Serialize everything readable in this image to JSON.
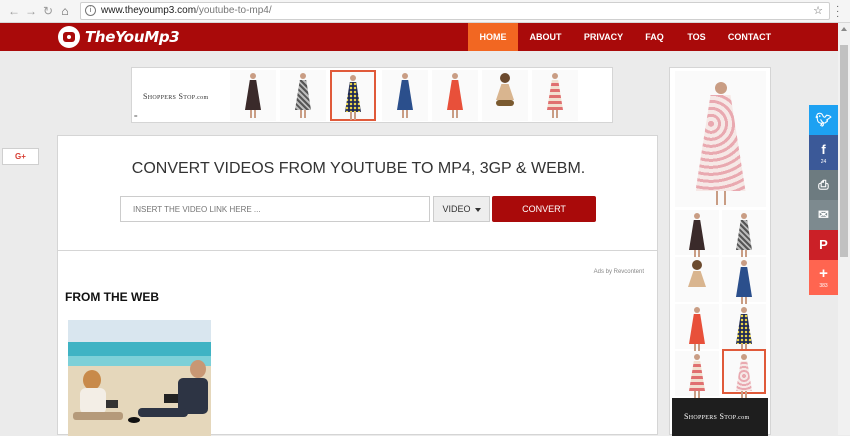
{
  "browser": {
    "url_domain": "www.theyoump3.com",
    "url_path": "/youtube-to-mp4/"
  },
  "nav": {
    "logo": "TheYouMp3",
    "items": [
      "HOME",
      "ABOUT",
      "PRIVACY",
      "FAQ",
      "TOS",
      "CONTACT"
    ],
    "active_index": 0
  },
  "ad_top": {
    "brand_main": "Shoppers Stop",
    "brand_suffix": ".com",
    "mini_icon": "="
  },
  "gplus": {
    "label": "G+"
  },
  "converter": {
    "headline": "CONVERT VIDEOS FROM YOUTUBE TO MP4, 3GP & WEBM.",
    "input_placeholder": "INSERT THE VIDEO LINK HERE ...",
    "format_selected": "VIDEO",
    "convert_label": "CONVERT"
  },
  "content": {
    "ads_by": "Ads by Revcontent",
    "from_web": "FROM THE WEB"
  },
  "sidebar_ad": {
    "brand_main": "Shoppers Stop",
    "brand_suffix": ".com"
  },
  "share": [
    {
      "icon": "twitter-icon",
      "glyph": "🐦",
      "count": "",
      "color": "#1da1f2"
    },
    {
      "icon": "facebook-icon",
      "glyph": "f",
      "count": "24",
      "color": "#3b5998"
    },
    {
      "icon": "print-icon",
      "glyph": "⎙",
      "count": "",
      "color": "#6d7b80"
    },
    {
      "icon": "email-icon",
      "glyph": "✉",
      "count": "",
      "color": "#7d8a8f"
    },
    {
      "icon": "pinterest-icon",
      "glyph": "P",
      "count": "",
      "color": "#cb2027"
    },
    {
      "icon": "more-icon",
      "glyph": "+",
      "count": "383",
      "color": "#ff6550"
    }
  ],
  "colors": {
    "brand_red": "#a90a0a",
    "nav_active": "#f26722"
  }
}
